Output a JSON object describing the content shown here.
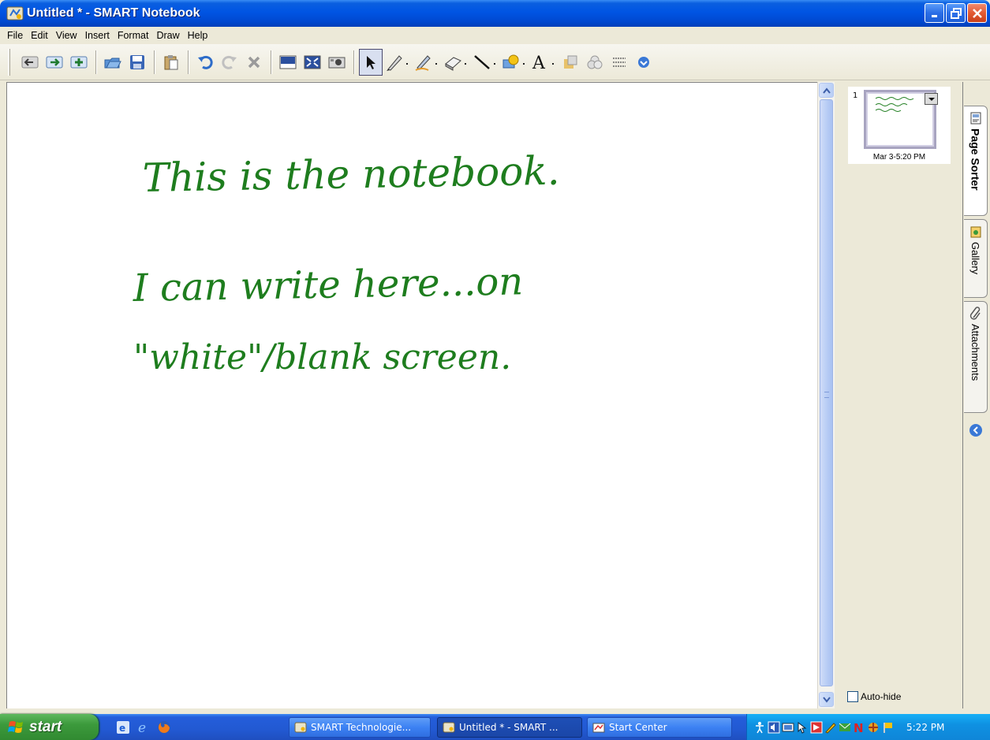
{
  "window": {
    "title": "Untitled * - SMART Notebook",
    "controls": [
      "minimize-icon",
      "restore-icon",
      "close-icon"
    ]
  },
  "menubar": {
    "items": [
      "File",
      "Edit",
      "View",
      "Insert",
      "Format",
      "Draw",
      "Help"
    ]
  },
  "toolbar": {
    "buttons": [
      "back-icon",
      "forward-icon",
      "add-page-icon",
      "open-icon",
      "save-icon",
      "paste-icon",
      "undo-icon",
      "redo-icon",
      "delete-icon",
      "screen-shade-icon",
      "full-screen-icon",
      "capture-icon",
      "select-icon",
      "pen-icon",
      "creative-pen-icon",
      "eraser-icon",
      "line-icon",
      "shapes-icon",
      "text-icon",
      "fill-icon",
      "properties-icon",
      "move-toolbar-icon",
      "more-icon"
    ],
    "colors": {
      "handwriting": "#1e7d1e",
      "selection": "#d8dff0"
    }
  },
  "canvas": {
    "handwritten_lines": [
      "This is the notebook.",
      "I can write here...on",
      "\"white\"/blank screen."
    ]
  },
  "page_sorter": {
    "page_number": "1",
    "page_label": "Mar 3-5:20 PM",
    "autohide_label": "Auto-hide",
    "autohide_checked": false
  },
  "side_tabs": [
    {
      "label": "Page Sorter",
      "icon": "page-sorter-icon",
      "active": true
    },
    {
      "label": "Gallery",
      "icon": "gallery-icon",
      "active": false
    },
    {
      "label": "Attachments",
      "icon": "paperclip-icon",
      "active": false
    }
  ],
  "taskbar": {
    "start_label": "start",
    "quicklaunch": [
      "internet-explorer-icon",
      "ie-icon",
      "firefox-icon"
    ],
    "tasks": [
      {
        "label": "SMART Technologie...",
        "active": false
      },
      {
        "label": "Untitled * - SMART ...",
        "active": true
      },
      {
        "label": "Start Center",
        "active": false
      }
    ],
    "clock": "5:22 PM"
  }
}
